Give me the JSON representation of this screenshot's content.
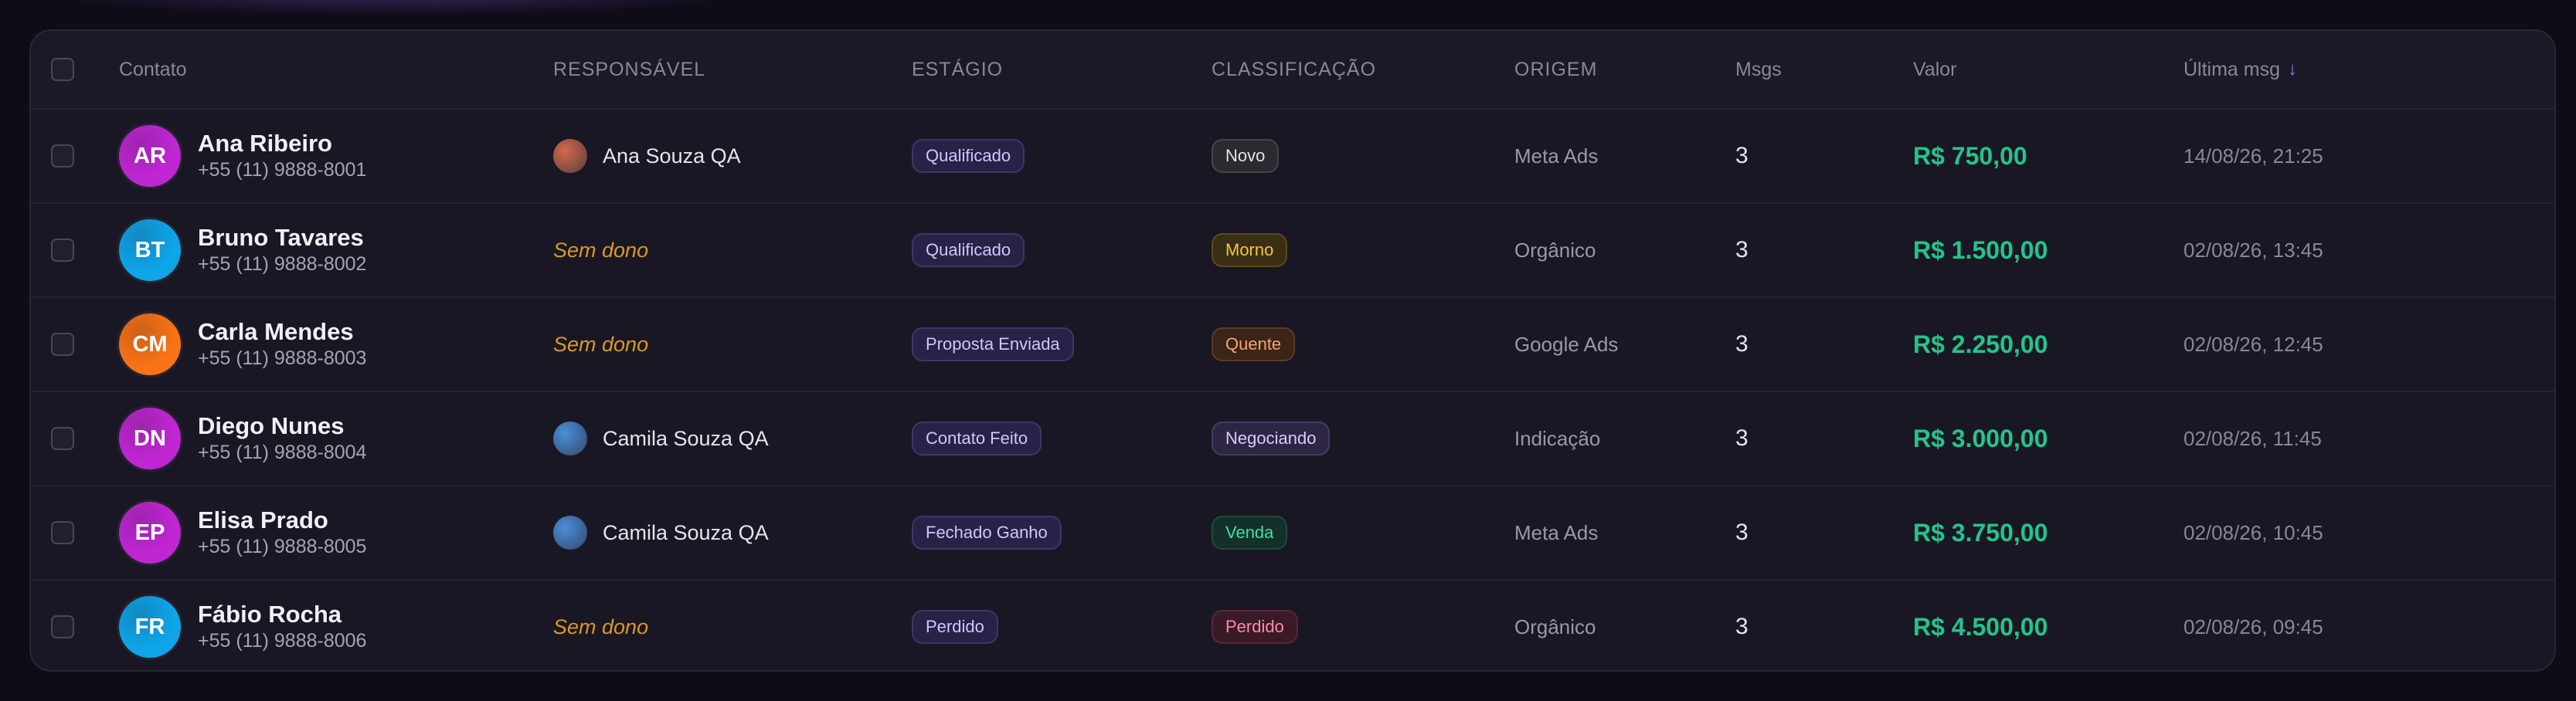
{
  "table": {
    "headers": {
      "contact": "Contato",
      "owner": "RESPONSÁVEL",
      "stage": "ESTÁGIO",
      "classification": "CLASSIFICAÇÃO",
      "origin": "ORIGEM",
      "msgs": "Msgs",
      "value": "Valor",
      "last_msg": "Última msg",
      "sort_icon": "↓"
    },
    "rows": [
      {
        "initials": "AR",
        "avatar_color": "#c026d3",
        "name": "Ana Ribeiro",
        "phone": "+55 (11) 9888-8001",
        "owner": "Ana Souza QA",
        "owner_color": "#d2694a",
        "no_owner": "",
        "stage": "Qualificado",
        "classification": "Novo",
        "class_style": "gray",
        "origin": "Meta Ads",
        "msgs": "3",
        "value": "R$ 750,00",
        "last_msg": "14/08/26, 21:25"
      },
      {
        "initials": "BT",
        "avatar_color": "#0ea5e9",
        "name": "Bruno Tavares",
        "phone": "+55 (11) 9888-8002",
        "owner": "",
        "owner_color": "",
        "no_owner": "Sem dono",
        "stage": "Qualificado",
        "classification": "Morno",
        "class_style": "yellow",
        "origin": "Orgânico",
        "msgs": "3",
        "value": "R$ 1.500,00",
        "last_msg": "02/08/26, 13:45"
      },
      {
        "initials": "CM",
        "avatar_color": "#f97316",
        "name": "Carla Mendes",
        "phone": "+55 (11) 9888-8003",
        "owner": "",
        "owner_color": "",
        "no_owner": "Sem dono",
        "stage": "Proposta Enviada",
        "classification": "Quente",
        "class_style": "orange",
        "origin": "Google Ads",
        "msgs": "3",
        "value": "R$ 2.250,00",
        "last_msg": "02/08/26, 12:45"
      },
      {
        "initials": "DN",
        "avatar_color": "#c026d3",
        "name": "Diego Nunes",
        "phone": "+55 (11) 9888-8004",
        "owner": "Camila Souza QA",
        "owner_color": "#4a8fd8",
        "no_owner": "",
        "stage": "Contato Feito",
        "classification": "Negociando",
        "class_style": "purple",
        "origin": "Indicação",
        "msgs": "3",
        "value": "R$ 3.000,00",
        "last_msg": "02/08/26, 11:45"
      },
      {
        "initials": "EP",
        "avatar_color": "#c026d3",
        "name": "Elisa Prado",
        "phone": "+55 (11) 9888-8005",
        "owner": "Camila Souza QA",
        "owner_color": "#4a8fd8",
        "no_owner": "",
        "stage": "Fechado Ganho",
        "classification": "Venda",
        "class_style": "green",
        "origin": "Meta Ads",
        "msgs": "3",
        "value": "R$ 3.750,00",
        "last_msg": "02/08/26, 10:45"
      },
      {
        "initials": "FR",
        "avatar_color": "#0ea5e9",
        "name": "Fábio Rocha",
        "phone": "+55 (11) 9888-8006",
        "owner": "",
        "owner_color": "",
        "no_owner": "Sem dono",
        "stage": "Perdido",
        "classification": "Perdido",
        "class_style": "red",
        "origin": "Orgânico",
        "msgs": "3",
        "value": "R$ 4.500,00",
        "last_msg": "02/08/26, 09:45"
      }
    ]
  }
}
